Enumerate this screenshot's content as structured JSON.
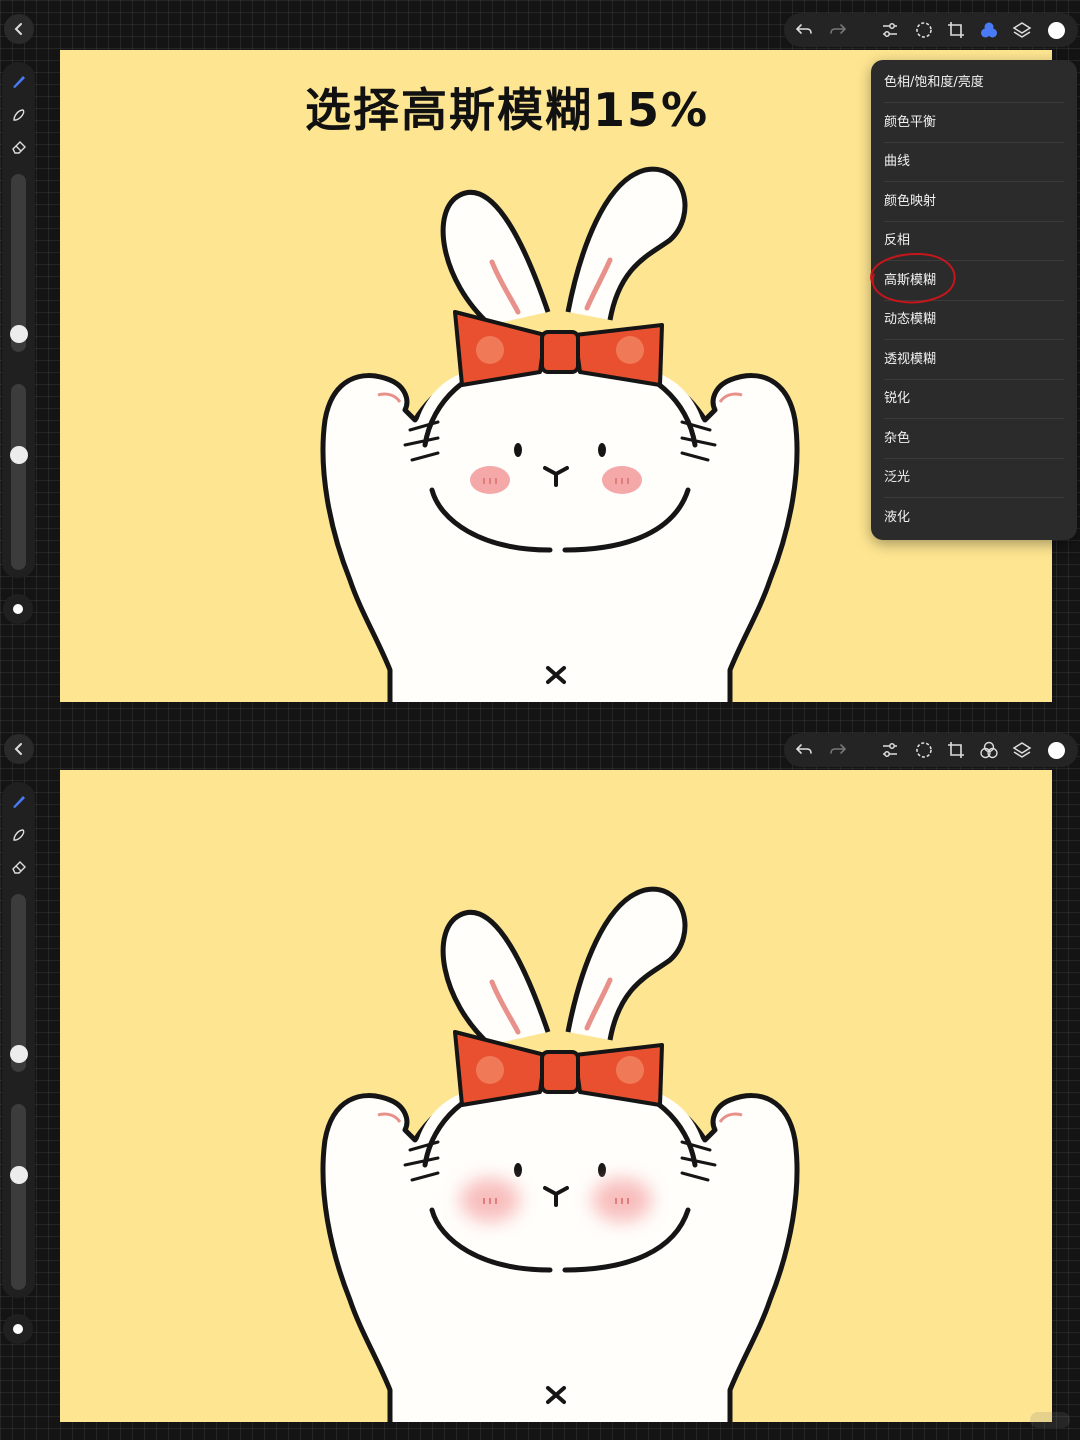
{
  "caption": "选择高斯模糊15%",
  "adjustments_menu": {
    "items": [
      {
        "label": "色相/饱和度/亮度"
      },
      {
        "label": "颜色平衡"
      },
      {
        "label": "曲线"
      },
      {
        "label": "颜色映射"
      },
      {
        "label": "反相"
      },
      {
        "label": "高斯模糊",
        "highlighted": true
      },
      {
        "label": "动态模糊"
      },
      {
        "label": "透视模糊"
      },
      {
        "label": "锐化"
      },
      {
        "label": "杂色"
      },
      {
        "label": "泛光"
      },
      {
        "label": "液化"
      }
    ],
    "highlight_color": "#c4161c"
  },
  "toolbar": {
    "icons": [
      "undo-icon",
      "redo-icon",
      "adjustments-icon",
      "selection-icon",
      "transform-icon",
      "color-icon",
      "layers-icon",
      "color-swatch"
    ],
    "active_color": "#4a7bf7"
  },
  "sidebar": {
    "tools": [
      "brush-icon",
      "smudge-icon",
      "eraser-icon"
    ],
    "brush_size_level": 0.8,
    "opacity_level": 0.4
  },
  "colors": {
    "canvas_background": "#fde591",
    "bow": "#e8502f",
    "blush": "#f5a8a8",
    "ear_inner": "#e8908a",
    "swatch": "#ffffff"
  },
  "panels": [
    {
      "id": "before",
      "blurred_blush": false,
      "menu_open": true
    },
    {
      "id": "after",
      "blurred_blush": true,
      "menu_open": false
    }
  ]
}
